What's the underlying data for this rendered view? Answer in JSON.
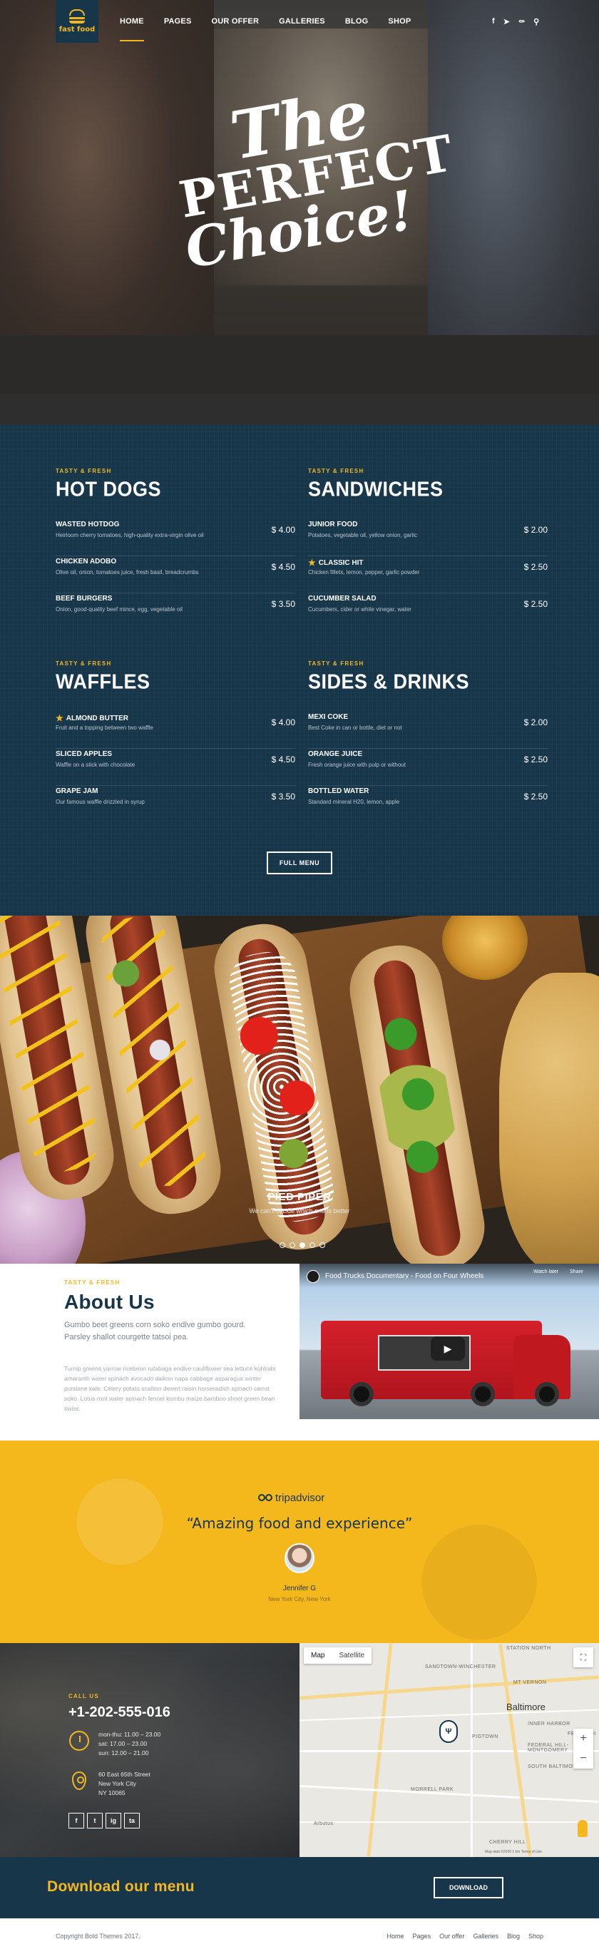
{
  "header": {
    "logo_text": "fast food",
    "nav": [
      "Home",
      "Pages",
      "Our offer",
      "Galleries",
      "Blog",
      "Shop"
    ],
    "active_nav": "Home",
    "social_icons": [
      "facebook-icon",
      "twitter-icon",
      "pinterest-icon",
      "search-icon"
    ]
  },
  "hero": {
    "line1": "The",
    "line2": "PERFECT",
    "line3": "Choice!"
  },
  "menu": {
    "categories": [
      {
        "kicker": "Tasty & Fresh",
        "title": "Hot Dogs",
        "items": [
          {
            "name": "Wasted Hotdog",
            "desc": "Heirloom cherry tomatoes, high-quality extra-virgin olive oil",
            "price": "$ 4.00",
            "star": false
          },
          {
            "name": "Chicken Adobo",
            "desc": "Olive oil, onion, tomatoes juice, fresh basil, breadcrumbs",
            "price": "$ 4.50",
            "star": false
          },
          {
            "name": "Beef Burgers",
            "desc": "Onion, good-quality beef mince, egg, vegetable oil",
            "price": "$ 3.50",
            "star": false
          }
        ]
      },
      {
        "kicker": "Tasty & Fresh",
        "title": "Sandwiches",
        "items": [
          {
            "name": "Junior Food",
            "desc": "Potatoes, vegetable oil, yellow onion, garlic",
            "price": "$ 2.00",
            "star": false
          },
          {
            "name": "Classic Hit",
            "desc": "Chicken fillets, lemon, pepper, garlic powder",
            "price": "$ 2.50",
            "star": true
          },
          {
            "name": "Cucumber Salad",
            "desc": "Cucumbers, cider or white vinegar, water",
            "price": "$ 2.50",
            "star": false
          }
        ]
      },
      {
        "kicker": "Tasty & Fresh",
        "title": "Waffles",
        "items": [
          {
            "name": "Almond Butter",
            "desc": "Fruit and a topping between two waffle",
            "price": "$ 4.00",
            "star": true
          },
          {
            "name": "Sliced Apples",
            "desc": "Waffle on a stick with chocolate",
            "price": "$ 4.50",
            "star": false
          },
          {
            "name": "Grape Jam",
            "desc": "Our famous waffle drizzled in syrup",
            "price": "$ 3.50",
            "star": false
          }
        ]
      },
      {
        "kicker": "Tasty & Fresh",
        "title": "Sides & Drinks",
        "items": [
          {
            "name": "Mexi Coke",
            "desc": "Best Coke in can or bottle, diet or not",
            "price": "$ 2.00",
            "star": false
          },
          {
            "name": "Orange Juice",
            "desc": "Fresh orange juice with pulp or without",
            "price": "$ 2.50",
            "star": false
          },
          {
            "name": "Bottled Water",
            "desc": "Standard mineral H20, lemon, apple",
            "price": "$ 2.50",
            "star": false
          }
        ]
      }
    ],
    "button": "Full Menu"
  },
  "slider": {
    "title": "Pied Piper",
    "subtitle": "We can't decide which one is better",
    "dot_count": 5,
    "active_dot": 2
  },
  "about": {
    "kicker": "Tasty & Fresh",
    "title": "About Us",
    "lead": "Gumbo beet greens corn soko endive gumbo gourd. Parsley shallot courgette tatsoi pea.",
    "body": "Turnip greens yarrow ricebean rutabaga endive cauliflower sea lettuce kohlrabi amaranth water spinach avocado daikon napa cabbage asparagus winter purslane kale. Celery potato scallion desert raisin horseradish spinach carrot soko. Lotus root water spinach fennel kombu maize bamboo shoot green bean swiss."
  },
  "video": {
    "title": "Food Trucks Documentary - Food on Four Wheels",
    "watch_later": "Watch later",
    "share": "Share"
  },
  "testimonial": {
    "brand": "tripadvisor",
    "quote": "“Amazing food and experience”",
    "name": "Jennifer G",
    "location": "New York City, New York"
  },
  "contact": {
    "kicker": "Call us",
    "phone": "+1-202-555-016",
    "hours": [
      "mon-thu: 11.00 – 23.00",
      "sat: 17.00 – 23.00",
      "sun: 12.00 – 21.00"
    ],
    "address": [
      "60 East 65th Street",
      "New York City",
      "NY 10065"
    ],
    "social": [
      "f",
      "t",
      "ig",
      "ta"
    ]
  },
  "map": {
    "tabs": [
      "Map",
      "Satellite"
    ],
    "active_tab": "Map",
    "city": "Baltimore",
    "labels": [
      "STATION NORTH",
      "SANDTOWN-WINCHESTER",
      "MT VERNON",
      "INNER HARBOR",
      "FELLS POI",
      "PIGTOWN",
      "FEDERAL HILL-MONTGOMERY",
      "SOUTH BALTIMORE",
      "MORRELL PARK",
      "CHERRY HILL",
      "Arbutus"
    ],
    "footer": "Map data ©2020   1 km   Terms of Use"
  },
  "download": {
    "title": "Download our menu",
    "button": "Download"
  },
  "footer": {
    "copyright": "Copyright Bold Themes 2017.",
    "links": [
      "Home",
      "Pages",
      "Our offer",
      "Galleries",
      "Blog",
      "Shop"
    ]
  },
  "colors": {
    "navy": "#17364a",
    "accent": "#f3b81f",
    "white": "#ffffff"
  }
}
